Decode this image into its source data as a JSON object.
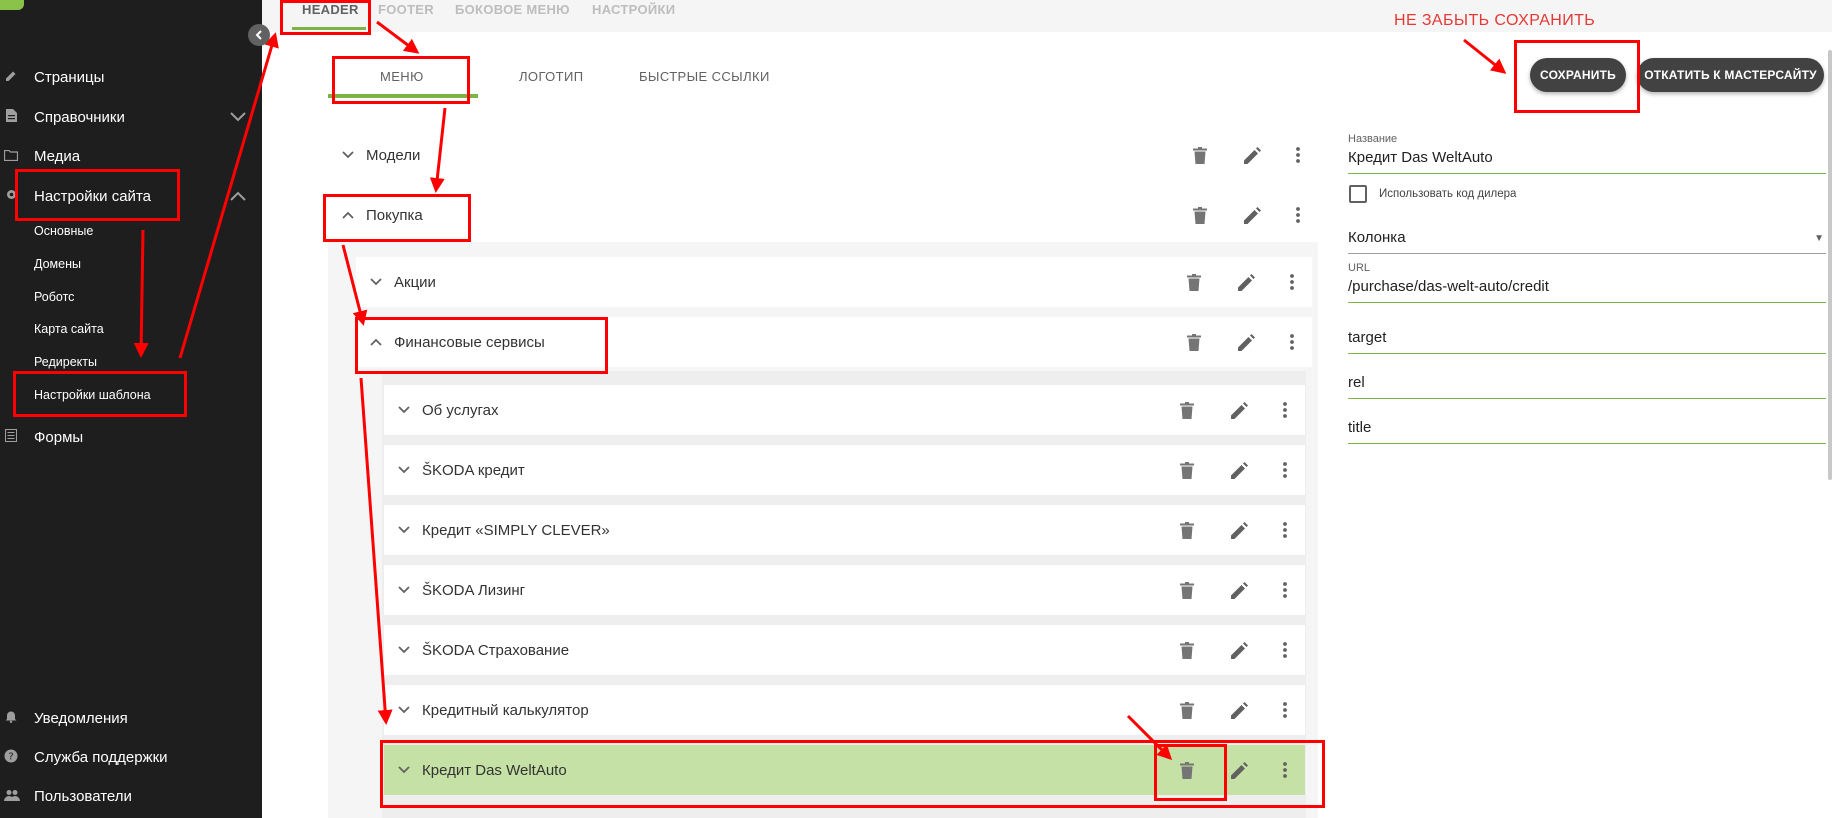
{
  "sidebar": {
    "items": [
      {
        "label": "Страницы",
        "icon": "pencil-icon"
      },
      {
        "label": "Справочники",
        "icon": "document-icon"
      },
      {
        "label": "Медиа",
        "icon": "folder-icon"
      },
      {
        "label": "Настройки сайта",
        "icon": "gear-icon"
      }
    ],
    "subitems": [
      "Основные",
      "Домены",
      "Роботс",
      "Карта сайта",
      "Редиректы",
      "Настройки шаблона"
    ],
    "forms": {
      "label": "Формы",
      "icon": "table-icon"
    },
    "bottom": [
      {
        "label": "Уведомления",
        "icon": "bell-icon"
      },
      {
        "label": "Служба поддержки",
        "icon": "help-icon"
      },
      {
        "label": "Пользователи",
        "icon": "users-icon"
      }
    ]
  },
  "top_tabs": [
    "HEADER",
    "FOOTER",
    "БОКОВОЕ МЕНЮ",
    "НАСТРОЙКИ"
  ],
  "sub_tabs": [
    "МЕНЮ",
    "ЛОГОТИП",
    "БЫСТРЫЕ ССЫЛКИ"
  ],
  "buttons": {
    "save": "СОХРАНИТЬ",
    "rollback": "ОТКАТИТЬ К МАСТЕРСАЙТУ"
  },
  "hint": "НЕ ЗАБЫТЬ СОХРАНИТЬ",
  "tree": {
    "level0": [
      "Модели",
      "Покупка"
    ],
    "level1": [
      "Акции",
      "Финансовые сервисы"
    ],
    "level2": [
      "Об услугах",
      "ŠKODA кредит",
      "Кредит «SIMPLY CLEVER»",
      "ŠKODA Лизинг",
      "ŠKODA Страхование",
      "Кредитный калькулятор",
      "Кредит Das WeltAuto"
    ]
  },
  "form": {
    "name_label": "Название",
    "name_value": "Кредит Das WeltAuto",
    "checkbox_label": "Использовать код дилера",
    "column_value": "Колонка",
    "url_label": "URL",
    "url_value": "/purchase/das-welt-auto/credit",
    "target_value": "target",
    "rel_value": "rel",
    "title_value": "title"
  },
  "colors": {
    "accent": "#7cb342",
    "selected_row": "#c5e1a5",
    "annotation": "#ff0000",
    "sidebar": "#1e1e1e"
  }
}
